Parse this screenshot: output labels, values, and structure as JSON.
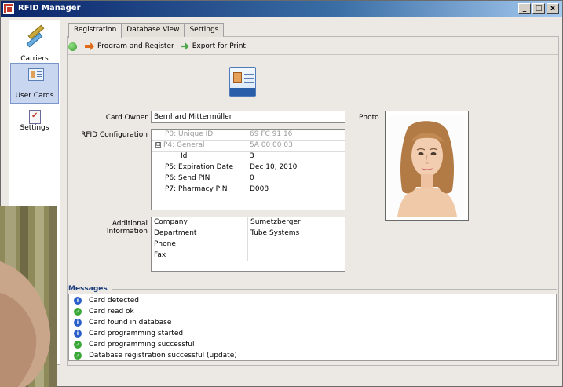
{
  "window": {
    "title": "RFID Manager",
    "minimize": "_",
    "maximize": "□",
    "close": "x"
  },
  "sidebar": {
    "items": [
      {
        "label": "Carriers",
        "icon": "carrier-icon"
      },
      {
        "label": "User Cards",
        "icon": "user-card-icon",
        "active": true
      },
      {
        "label": "Settings",
        "icon": "checklist-icon"
      }
    ]
  },
  "tabs": [
    {
      "label": "Registration",
      "active": true
    },
    {
      "label": "Database View"
    },
    {
      "label": "Settings"
    }
  ],
  "toolbar": {
    "program_label": "Program and Register",
    "export_label": "Export for Print"
  },
  "form": {
    "card_owner_label": "Card Owner",
    "card_owner_value": "Bernhard Mittermüller",
    "rfid_label": "RFID Configuration",
    "photo_label": "Photo",
    "additional_label": "Additional Information"
  },
  "rfid_rows": [
    {
      "name": "P0: Unique ID",
      "value": "69 FC 91 16",
      "muted": true
    },
    {
      "name": "P4: General",
      "value": "5A 00 00 03",
      "muted": true,
      "expander": "⊟"
    },
    {
      "name": "Id",
      "value": "3"
    },
    {
      "name": "P5: Expiration Date",
      "value": "Dec 10, 2010"
    },
    {
      "name": "P6: Send PIN",
      "value": "0"
    },
    {
      "name": "P7: Pharmacy PIN",
      "value": "D008"
    }
  ],
  "additional_rows": [
    {
      "name": "Company",
      "value": "Sumetzberger"
    },
    {
      "name": "Department",
      "value": "Tube Systems"
    },
    {
      "name": "Phone",
      "value": ""
    },
    {
      "name": "Fax",
      "value": ""
    }
  ],
  "messages": {
    "header": "Messages",
    "items": [
      {
        "text": "Card detected",
        "type": "info"
      },
      {
        "text": "Card read ok",
        "type": "ok"
      },
      {
        "text": "Card found in database",
        "type": "info"
      },
      {
        "text": "Card programming started",
        "type": "info"
      },
      {
        "text": "Card programming successful",
        "type": "ok"
      },
      {
        "text": "Database registration successful (update)",
        "type": "ok"
      }
    ]
  },
  "colors": {
    "titlebar": "#0a246a",
    "info": "#2a5ec8",
    "ok": "#3aa838",
    "active_sidebar": "#c8d6f0"
  }
}
